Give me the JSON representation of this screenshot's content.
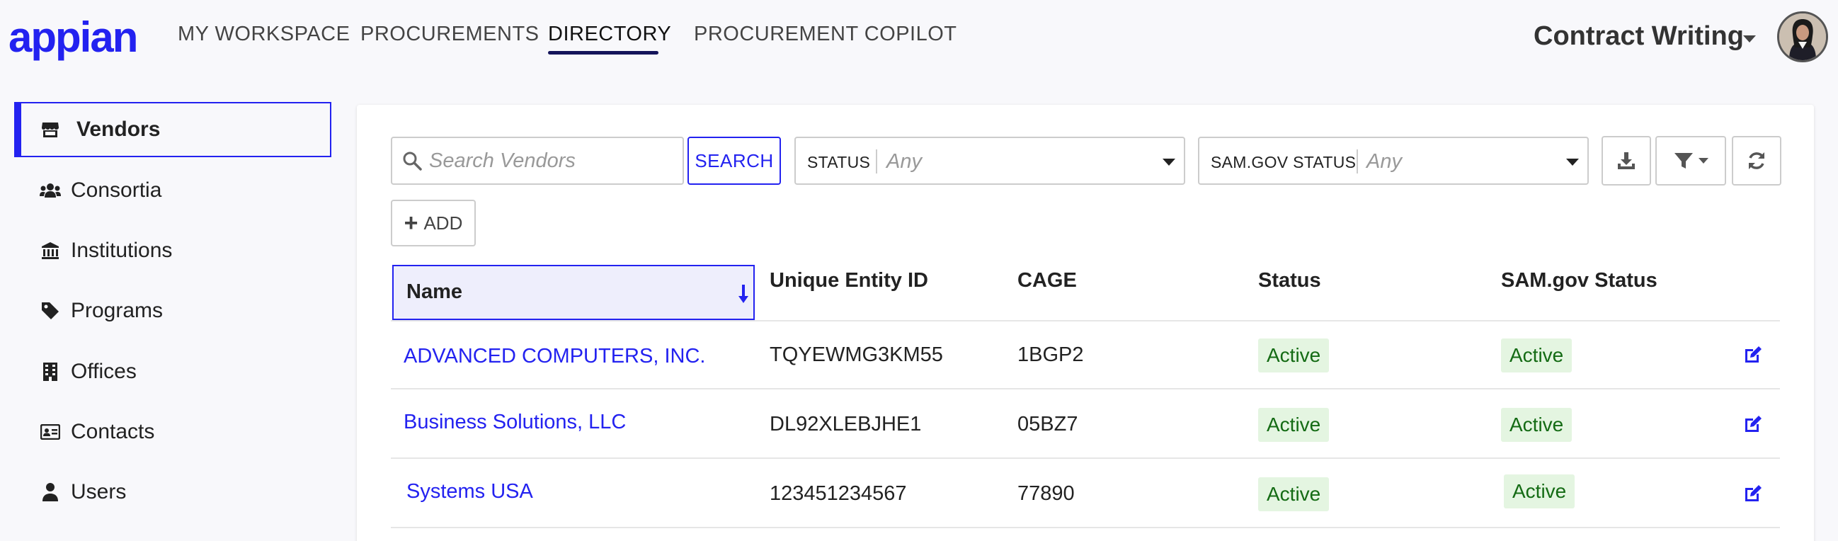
{
  "header": {
    "logo": "appian",
    "tabs": [
      {
        "label": "MY WORKSPACE"
      },
      {
        "label": "PROCUREMENTS"
      },
      {
        "label": "DIRECTORY"
      },
      {
        "label": "PROCUREMENT COPILOT"
      }
    ],
    "active_tab": "DIRECTORY",
    "app_switcher": "Contract Writing"
  },
  "sidebar": {
    "items": [
      {
        "label": "Vendors",
        "icon": "store-icon"
      },
      {
        "label": "Consortia",
        "icon": "users-icon"
      },
      {
        "label": "Institutions",
        "icon": "institution-icon"
      },
      {
        "label": "Programs",
        "icon": "tag-icon"
      },
      {
        "label": "Offices",
        "icon": "building-icon"
      },
      {
        "label": "Contacts",
        "icon": "id-card-icon"
      },
      {
        "label": "Users",
        "icon": "user-icon"
      }
    ],
    "active": "Vendors"
  },
  "toolbar": {
    "search_placeholder": "Search Vendors",
    "search_button": "SEARCH",
    "status_filter": {
      "label": "STATUS",
      "value": "Any"
    },
    "sam_filter": {
      "label": "SAM.GOV STATUS",
      "value": "Any"
    },
    "add_button": "ADD"
  },
  "table": {
    "columns": [
      "Name",
      "Unique Entity ID",
      "CAGE",
      "Status",
      "SAM.gov Status"
    ],
    "sort": {
      "column": "Name",
      "direction": "descending"
    },
    "rows": [
      {
        "name": "ADVANCED COMPUTERS, INC.",
        "uei": "TQYEWMG3KM55",
        "cage": "1BGP2",
        "status": "Active",
        "sam_status": "Active"
      },
      {
        "name": "Business Solutions, LLC",
        "uei": "DL92XLEBJHE1",
        "cage": "05BZ7",
        "status": "Active",
        "sam_status": "Active"
      },
      {
        "name": "Systems USA",
        "uei": "123451234567",
        "cage": "77890",
        "status": "Active",
        "sam_status": "Active"
      }
    ]
  },
  "colors": {
    "accent": "#2322f0",
    "nav_underline": "#14145a",
    "badge_bg": "#e4f5e1",
    "badge_text": "#146b14"
  }
}
